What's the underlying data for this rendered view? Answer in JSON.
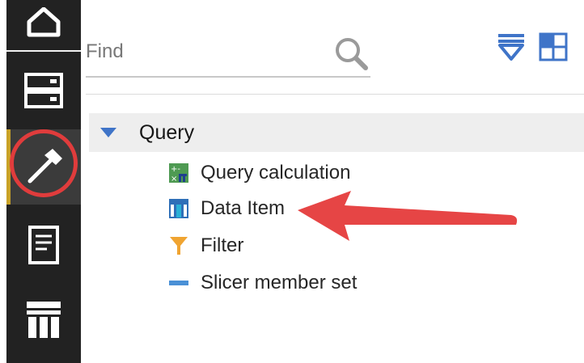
{
  "search": {
    "placeholder": "Find"
  },
  "tree": {
    "group_label": "Query",
    "items": [
      {
        "label": "Query calculation",
        "icon": "query-calculation-icon"
      },
      {
        "label": "Data Item",
        "icon": "data-item-icon"
      },
      {
        "label": "Filter",
        "icon": "filter-icon"
      },
      {
        "label": "Slicer member set",
        "icon": "slicer-member-set-icon"
      }
    ]
  },
  "colors": {
    "rail": "#222222",
    "accent_blue": "#3f74c8",
    "annotation_red": "#e03c3c",
    "active_indicator": "#c9a227"
  }
}
